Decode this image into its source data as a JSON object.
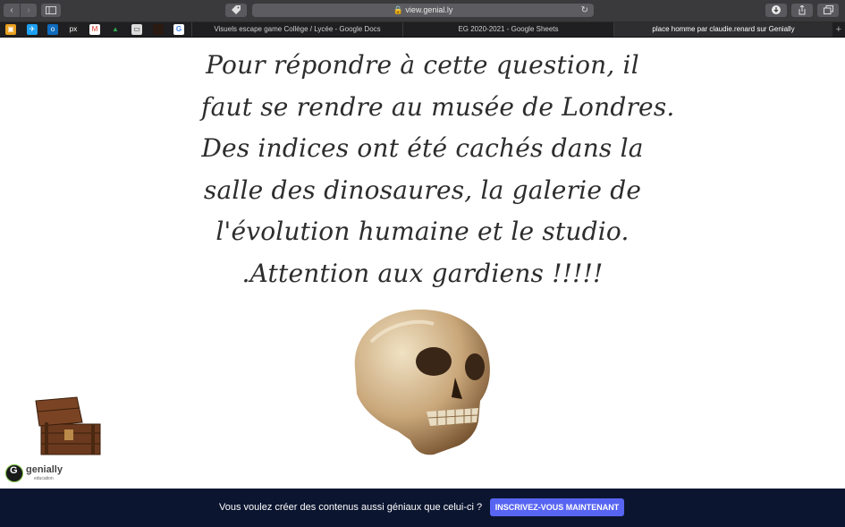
{
  "browser": {
    "url": "view.genial.ly",
    "tabs": [
      {
        "label": "Visuels escape game Collège / Lycée - Google Docs",
        "active": false
      },
      {
        "label": "EG 2020-2021 - Google Sheets",
        "active": false
      },
      {
        "label": "place homme par claudie.renard sur Genially",
        "active": true
      }
    ],
    "bookmarks": [
      "bookmark-icon",
      "twitter-icon",
      "outlook-icon",
      "pix-icon",
      "gmail-icon",
      "drive-icon",
      "classroom-icon",
      "dark-icon",
      "google-icon"
    ]
  },
  "content": {
    "riddle_lines": [
      "Pour répondre à cette question, il",
      "faut se rendre au musée de Londres.",
      "Des indices ont été cachés dans la",
      "salle des dinosaures, la galerie de",
      "l'évolution humaine et le studio.",
      ".Attention aux gardiens !!!!!"
    ],
    "brand": {
      "name": "genially",
      "sub": "education"
    }
  },
  "footer": {
    "message": "Vous voulez créer des contenus aussi géniaux que celui-ci ?",
    "cta": "INSCRIVEZ-VOUS MAINTENANT"
  },
  "colors": {
    "footer_bg": "#0b1530",
    "cta_bg": "#5865f2",
    "chrome": "#3a3a3c"
  }
}
